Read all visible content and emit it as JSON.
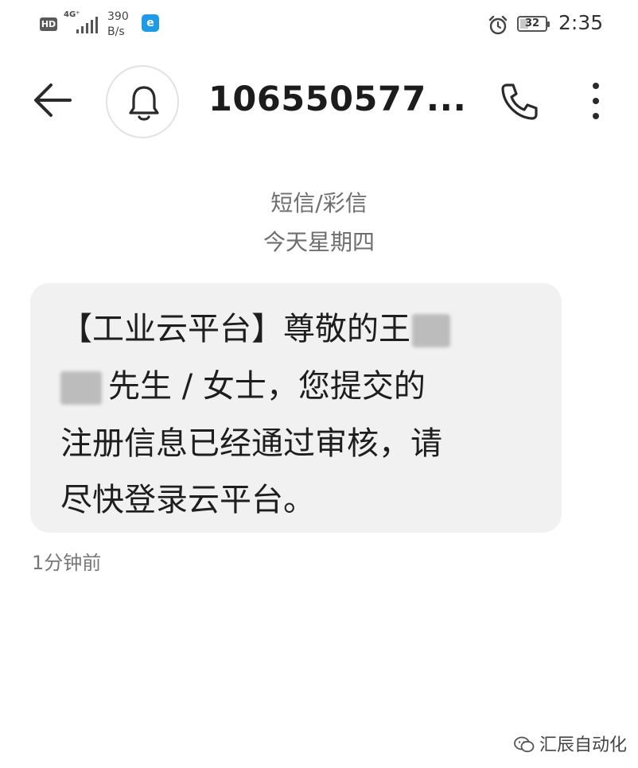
{
  "status_bar": {
    "hd_badge": "HD",
    "network_type": "4G⁺",
    "speed_value": "390",
    "speed_unit": "B/s",
    "battery_level": "32",
    "time": "2:35"
  },
  "header": {
    "contact_name": "106550577..."
  },
  "conversation": {
    "category_label": "短信/彩信",
    "day_label": "今天星期四",
    "message": {
      "line1": "【工业云平台】尊敬的王",
      "line2": "先生 / 女士，您提交的",
      "line3": "注册信息已经通过审核，请",
      "line4": "尽快登录云平台。",
      "timestamp": "1分钟前"
    }
  },
  "watermark": {
    "text": "汇辰自动化"
  },
  "icons": {
    "back": "back-arrow-icon",
    "avatar": "bell-icon",
    "call": "phone-icon",
    "menu": "more-vertical-icon",
    "status": [
      "hd-badge",
      "signal-icon",
      "app-notification-icon",
      "alarm-icon",
      "battery-icon"
    ]
  },
  "colors": {
    "bubble_bg": "#f1f1f1",
    "secondary_text": "#6e6e6e",
    "app_icon": "#1e9ae6"
  }
}
